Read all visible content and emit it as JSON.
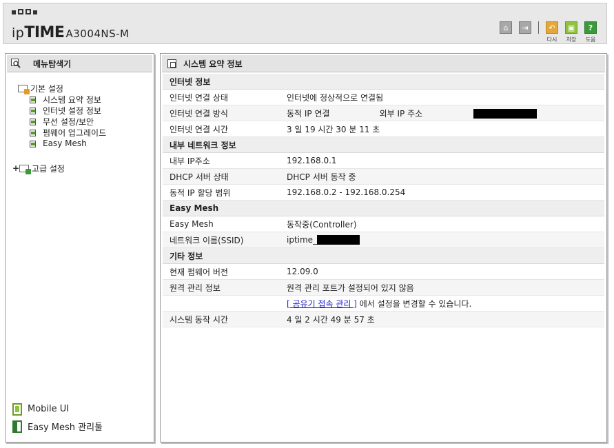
{
  "header": {
    "logo_prefix": "ip",
    "logo_bold": "TIME",
    "model": "A3004NS-M",
    "toolbar": [
      {
        "label": "",
        "icon": "home-icon"
      },
      {
        "label": "",
        "icon": "logout-icon"
      },
      {
        "label": "다시",
        "icon": "refresh-icon"
      },
      {
        "label": "저장",
        "icon": "save-icon"
      },
      {
        "label": "도움",
        "icon": "help-icon"
      }
    ]
  },
  "sidebar": {
    "title": "메뉴탐색기",
    "basic_label": "기본 설정",
    "basic_items": [
      "시스템 요약 정보",
      "인터넷 설정 정보",
      "무선 설정/보안",
      "펌웨어 업그레이드",
      "Easy Mesh"
    ],
    "advanced_label": "고급 설정",
    "mobile_ui": "Mobile UI",
    "easymesh_tool": "Easy Mesh 관리툴"
  },
  "main": {
    "title": "시스템 요약 정보",
    "internet": {
      "title": "인터넷 정보",
      "status_label": "인터넷 연결 상태",
      "status_value": "인터넷에 정상적으로 연결됨",
      "method_label": "인터넷 연결 방식",
      "method_value": "동적 IP 연결",
      "external_ip_label": "외부 IP 주소",
      "time_label": "인터넷 연결 시간",
      "time_value": "3 일 19 시간 30 분 11 초"
    },
    "lan": {
      "title": "내부 네트워크 정보",
      "ip_label": "내부 IP주소",
      "ip_value": "192.168.0.1",
      "dhcp_label": "DHCP 서버 상태",
      "dhcp_value": "DHCP 서버 동작 중",
      "range_label": "동적 IP 할당 범위",
      "range_value": "192.168.0.2 -  192.168.0.254"
    },
    "mesh": {
      "title": "Easy Mesh",
      "mesh_label": "Easy Mesh",
      "mesh_value": "동작중(Controller)",
      "ssid_label": "네트워크 이름(SSID)",
      "ssid_value": "iptime_"
    },
    "etc": {
      "title": "기타 정보",
      "fw_label": "현재 펌웨어 버전",
      "fw_value": "12.09.0",
      "remote_label": "원격 관리 정보",
      "remote_value": "원격 관리 포트가 설정되어 있지 않음",
      "remote_link": "[ 공유기 접속 관리 ]",
      "remote_hint": " 에서 설정을 변경할 수 있습니다.",
      "uptime_label": "시스템 동작 시간",
      "uptime_value": "4 일 2 시간 49 분 57 초"
    }
  }
}
